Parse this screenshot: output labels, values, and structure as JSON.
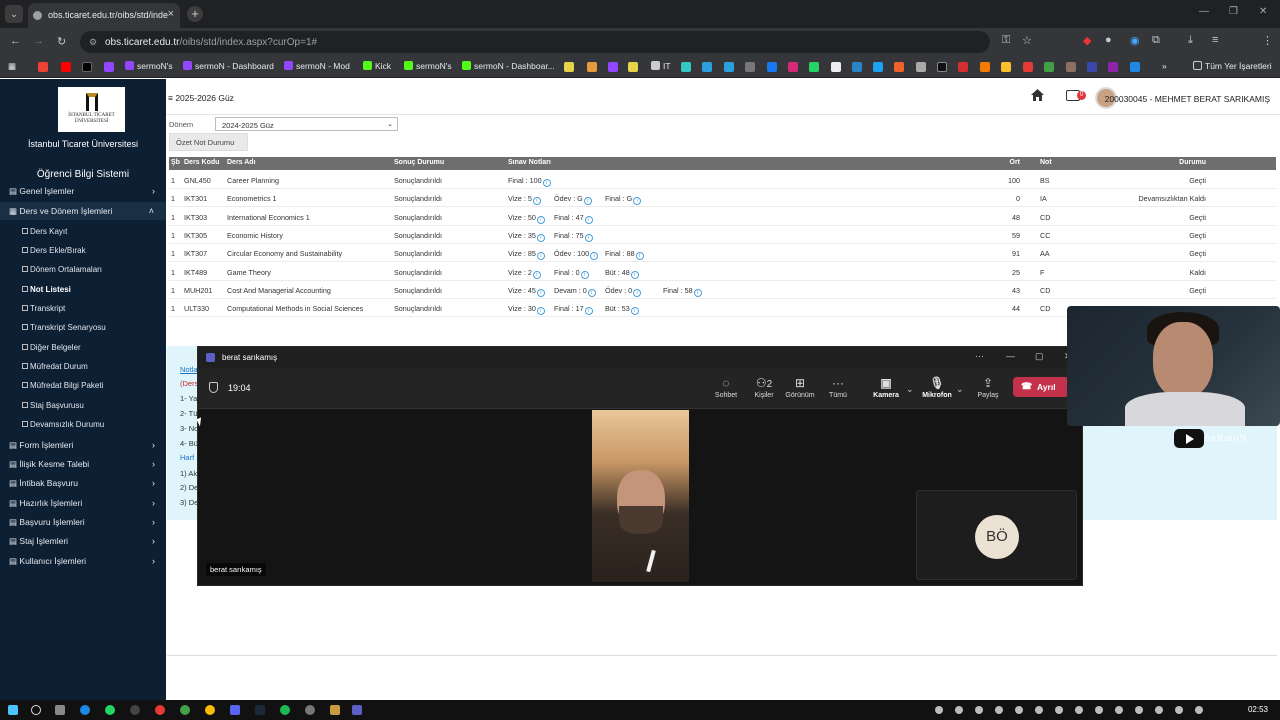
{
  "browser": {
    "tab_title": "obs.ticaret.edu.tr/oibs/std/inde",
    "tab_close": "×",
    "new_tab": "+",
    "url_host": "obs.ticaret.edu.tr",
    "url_path": "/oibs/std/index.aspx?curOp=1#",
    "bookmarks": [
      "sermoN's",
      "sermoN - Dashboard",
      "sermoN - Mod",
      "Kick",
      "sermoN's",
      "sermoN - Dashboar...",
      "IT"
    ],
    "all_bookmarks": "Tüm Yer İşaretleri"
  },
  "sidebar": {
    "university": "İstanbul Ticaret Üniversitesi",
    "logo_lines": [
      "İSTANBUL TİCARET",
      "ÜNİVERSİTESİ"
    ],
    "system_title": "Öğrenci Bilgi Sistemi",
    "menu": [
      "Genel İşlemler",
      "Ders ve Dönem İşlemleri",
      "Form İşlemleri",
      "İlişik Kesme Talebi",
      "İntibak Başvuru",
      "Hazırlık İşlemleri",
      "Başvuru İşlemleri",
      "Staj İşlemleri",
      "Kullanıcı İşlemleri"
    ],
    "submenu": [
      "Ders Kayıt",
      "Ders Ekle/Bırak",
      "Dönem Ortalamaları",
      "Not Listesi",
      "Transkript",
      "Transkript Senaryosu",
      "Diğer Belgeler",
      "Müfredat Durum",
      "Müfredat Bilgi Paketi",
      "Staj Başvurusu",
      "Devamsızlık Durumu"
    ]
  },
  "header": {
    "term": "2025-2026 Güz",
    "notif_count": "0",
    "user": "200030045 - MEHMET BERAT SARIKAMIŞ"
  },
  "filter": {
    "label": "Dönem",
    "value": "2024-2025 Güz",
    "summary_btn": "Özet Not Durumu"
  },
  "table": {
    "headers": [
      "Şb",
      "Ders Kodu",
      "Ders Adı",
      "Sonuç Durumu",
      "Sınav Notları",
      "Ort",
      "Not",
      "Durumu"
    ],
    "rows": [
      {
        "sb": "1",
        "code": "GNL450",
        "name": "Career Planning",
        "result": "Sonuçlandırıldı",
        "g1": "Final : 100",
        "g2": "",
        "g3": "",
        "avg": "100",
        "grade": "BS",
        "status": "Geçti"
      },
      {
        "sb": "1",
        "code": "IKT301",
        "name": "Econometrics 1",
        "result": "Sonuçlandırıldı",
        "g1": "Vize : 5",
        "g2": "Ödev : G",
        "g3": "Final : G",
        "avg": "0",
        "grade": "IA",
        "status": "Devamsızlıktan Kaldı"
      },
      {
        "sb": "1",
        "code": "IKT303",
        "name": "International Economics 1",
        "result": "Sonuçlandırıldı",
        "g1": "Vize : 50",
        "g2": "Final : 47",
        "g3": "",
        "avg": "48",
        "grade": "CD",
        "status": "Geçti"
      },
      {
        "sb": "1",
        "code": "IKT305",
        "name": "Economic History",
        "result": "Sonuçlandırıldı",
        "g1": "Vize : 35",
        "g2": "Final : 75",
        "g3": "",
        "avg": "59",
        "grade": "CC",
        "status": "Geçti"
      },
      {
        "sb": "1",
        "code": "IKT307",
        "name": "Circular Economy and Sustainability",
        "result": "Sonuçlandırıldı",
        "g1": "Vize : 85",
        "g2": "Ödev : 100",
        "g3": "Final : 88",
        "avg": "91",
        "grade": "AA",
        "status": "Geçti"
      },
      {
        "sb": "1",
        "code": "IKT489",
        "name": "Game Theory",
        "result": "Sonuçlandırıldı",
        "g1": "Vize : 2",
        "g2": "Final : 0",
        "g3": "Büt : 48",
        "avg": "25",
        "grade": "F",
        "status": "Kaldı"
      },
      {
        "sb": "1",
        "code": "MUH201",
        "name": "Cost And Managerial Accounting",
        "result": "Sonuçlandırıldı",
        "g1": "Vize : 45",
        "g2": "Devam : 0",
        "g3": "Ödev : 0",
        "g4": "Final : 58",
        "avg": "43",
        "grade": "CD",
        "status": "Geçti"
      },
      {
        "sb": "1",
        "code": "ULT330",
        "name": "Computational Methods in Social Sciences",
        "result": "Sonuçlandırıldı",
        "g1": "Vize : 30",
        "g2": "Final : 17",
        "g3": "Büt : 53",
        "avg": "44",
        "grade": "CD",
        "status": ""
      }
    ]
  },
  "notes_fragments": [
    "Notla",
    "(Ders",
    "1- Ya",
    "2- Tü",
    "3- No",
    "4- Bü",
    "Harf",
    "1) Ak",
    "2) De",
    "3) De"
  ],
  "teams": {
    "window_title": "berat sarıkamış",
    "timer": "19:04",
    "toolbar": [
      "Sohbet",
      "Kişiler",
      "Görünüm",
      "Tümü",
      "Kamera",
      "Mikrofon",
      "Paylaş"
    ],
    "people_count": "2",
    "leave": "Ayrıl",
    "participant_name": "berat sarıkamış",
    "self_initials": "BÖ"
  },
  "overlay": {
    "channel": "SeRmoN"
  },
  "taskbar": {
    "time": "02:53"
  },
  "colors": {
    "sidebar_bg": "#0d1f33",
    "table_header": "#6e6e6e",
    "teams_bg": "#141414",
    "leave_red": "#c4314b",
    "notes_bg": "#e0f4fb"
  }
}
